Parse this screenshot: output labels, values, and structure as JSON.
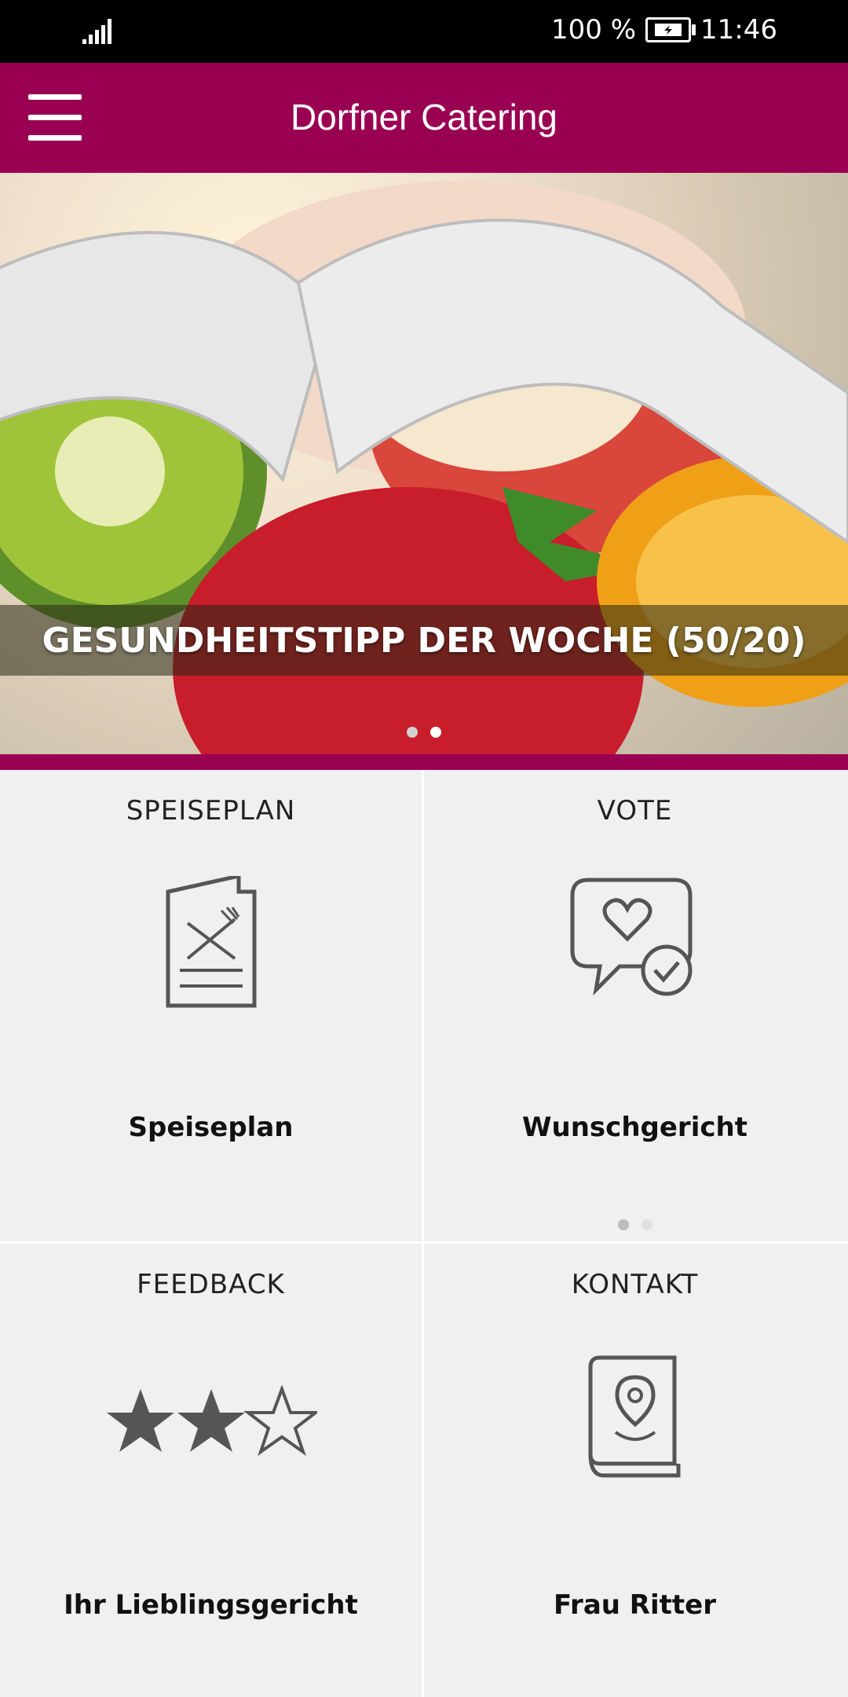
{
  "status_bar": {
    "battery_text": "100 %",
    "time": "11:46",
    "icons": [
      "signal-icon",
      "battery-icon"
    ]
  },
  "app_bar": {
    "title": "Dorfner Catering",
    "menu_icon": "hamburger-menu-icon"
  },
  "hero": {
    "caption": "GESUNDHEITSTIPP DER WOCHE (50/20)",
    "slides_count": 2,
    "active_slide": 2
  },
  "tiles": [
    {
      "title": "SPEISEPLAN",
      "icon": "menu-card-icon",
      "subtitle": "Speiseplan"
    },
    {
      "title": "VOTE",
      "icon": "heart-check-bubble-icon",
      "subtitle": "Wunschgericht",
      "dots": 2
    },
    {
      "title": "FEEDBACK",
      "icon": "star-rating-icon",
      "subtitle": "Ihr Lieblingsgericht",
      "rating": "2/3"
    },
    {
      "title": "KONTAKT",
      "icon": "contact-book-icon",
      "subtitle": "Frau Ritter"
    }
  ],
  "colors": {
    "primary": "#9a0052",
    "background": "#efefef",
    "icon": "#555555"
  }
}
